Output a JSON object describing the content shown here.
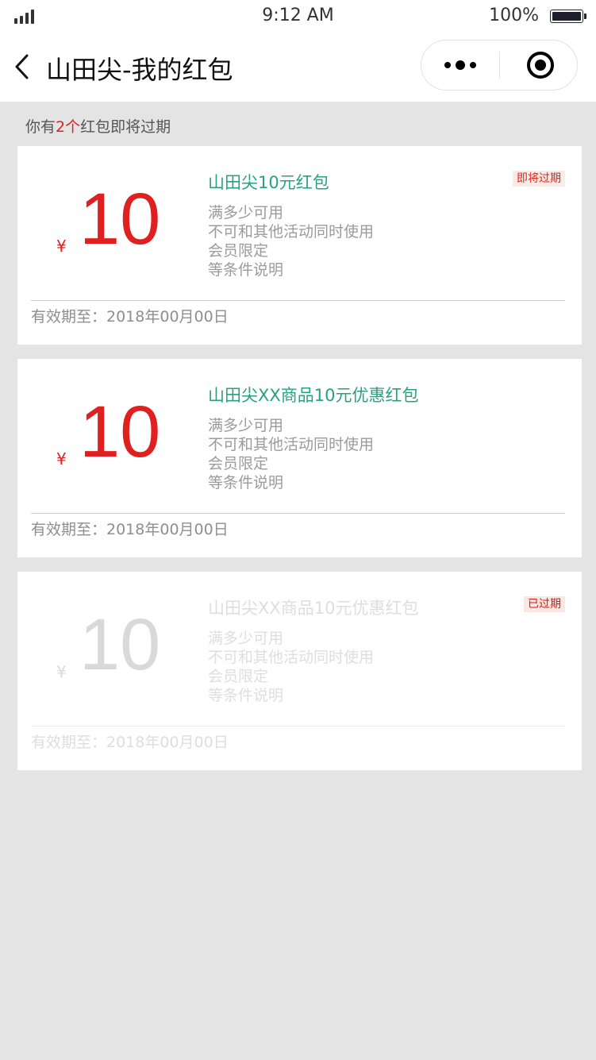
{
  "status_bar": {
    "time": "9:12 AM",
    "battery": "100%"
  },
  "nav": {
    "title": "山田尖-我的红包",
    "back_icon": "chevron-left-icon",
    "more_icon": "more-dots-icon",
    "close_icon": "target-icon"
  },
  "notice": {
    "prefix": "你有",
    "count": "2个",
    "suffix": "红包即将过期"
  },
  "colors": {
    "amount": "#e02020",
    "title": "#27a27c",
    "background": "#e5e4e5"
  },
  "coupons": [
    {
      "currency": "¥",
      "amount": "10",
      "title": "山田尖10元红包",
      "badge": "即将过期",
      "conditions": [
        "满多少可用",
        "不可和其他活动同时使用",
        "会员限定",
        "等条件说明"
      ],
      "validity": "有效期至：2018年00月00日",
      "state": "expiring"
    },
    {
      "currency": "¥",
      "amount": "10",
      "title": "山田尖XX商品10元优惠红包",
      "badge": "",
      "conditions": [
        "满多少可用",
        "不可和其他活动同时使用",
        "会员限定",
        "等条件说明"
      ],
      "validity": "有效期至：2018年00月00日",
      "state": "active"
    },
    {
      "currency": "¥",
      "amount": "10",
      "title": "山田尖XX商品10元优惠红包",
      "badge": "已过期",
      "conditions": [
        "满多少可用",
        "不可和其他活动同时使用",
        "会员限定",
        "等条件说明"
      ],
      "validity": "有效期至：2018年00月00日",
      "state": "expired"
    }
  ]
}
